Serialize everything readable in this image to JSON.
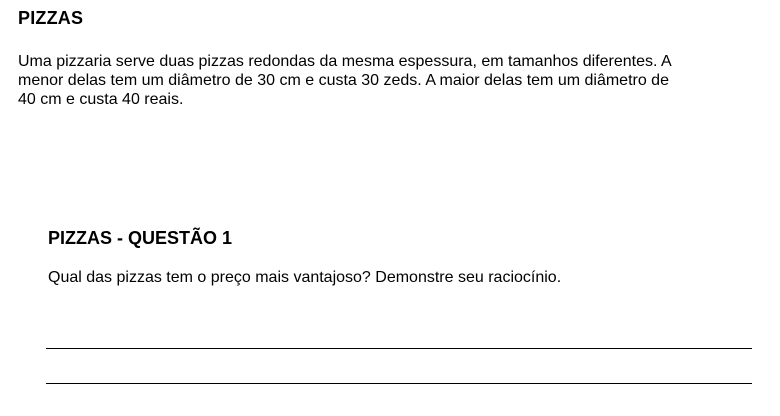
{
  "unit": {
    "title": "PIZZAS",
    "intro_lines": [
      "Uma pizzaria serve duas pizzas redondas da mesma espessura, em tamanhos diferentes. A",
      "menor delas tem um diâmetro de 30 cm e custa 30 zeds. A maior delas tem um diâmetro de",
      "40 cm e custa 40 reais."
    ]
  },
  "question": {
    "title": "PIZZAS - QUESTÃO 1",
    "text": "Qual das pizzas tem o preço mais vantajoso? Demonstre seu raciocínio."
  }
}
